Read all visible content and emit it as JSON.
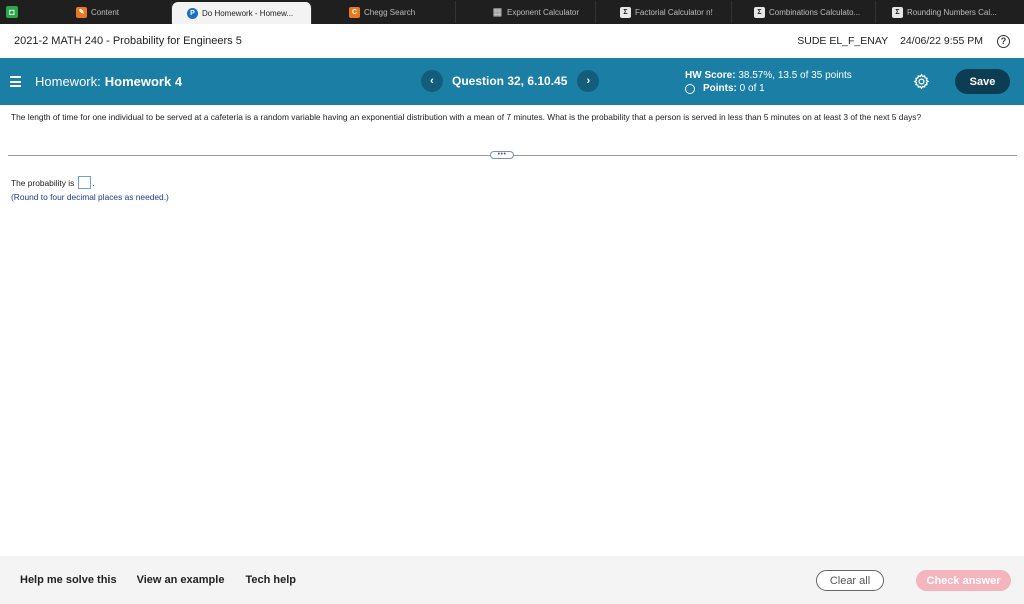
{
  "tabs": [
    {
      "label": "Content",
      "icon": "pencil-icon",
      "color": "#e8791e",
      "glyph": "✎"
    },
    {
      "label": "Do Homework - Homew...",
      "icon": "pearson-icon",
      "color": "#1a6fbf",
      "glyph": "P"
    },
    {
      "label": "Chegg Search",
      "icon": "chegg-icon",
      "color": "#e8791e",
      "glyph": "C"
    },
    {
      "label": "Exponent Calculator",
      "icon": "calculator-icon",
      "color": "#8a8a8a",
      "glyph": "▦"
    },
    {
      "label": "Factorial Calculator n!",
      "icon": "sigma-icon",
      "color": "#8a8a8a",
      "glyph": "Σ"
    },
    {
      "label": "Combinations Calculato...",
      "icon": "sigma-icon",
      "color": "#8a8a8a",
      "glyph": "Σ"
    },
    {
      "label": "Rounding Numbers Cal...",
      "icon": "sigma-icon",
      "color": "#8a8a8a",
      "glyph": "Σ"
    }
  ],
  "course": {
    "title": "2021-2 MATH 240 - Probability for Engineers 5",
    "user": "SUDE EL_F_ENAY",
    "datetime": "24/06/22 9:55 PM",
    "help_glyph": "?"
  },
  "homework": {
    "label": "Homework:",
    "name": "Homework 4",
    "question_label": "Question 32, 6.10.45",
    "prev_glyph": "‹",
    "next_glyph": "›",
    "hw_score_label": "HW Score:",
    "hw_score_value": "38.57%, 13.5 of 35 points",
    "points_label": "Points:",
    "points_value": "0 of 1",
    "save_label": "Save"
  },
  "question": {
    "text": "The length of time for one individual to be served at a cafeteria is a random variable having an exponential distribution with a mean of 7 minutes. What is the probability that a person is served in less than 5 minutes on at least 3 of the next 5 days?",
    "expand_glyph": "•••",
    "answer_prefix": "The probability is",
    "answer_value": "",
    "answer_suffix": ".",
    "note": "(Round to four decimal places as needed.)"
  },
  "footer": {
    "help_me_solve": "Help me solve this",
    "view_example": "View an example",
    "tech_help": "Tech help",
    "clear_all": "Clear all",
    "check_answer": "Check answer"
  },
  "colors": {
    "hw_bar": "#1a7ea5",
    "save_button": "#0c3d52",
    "check_answer": "#f4b5be"
  }
}
